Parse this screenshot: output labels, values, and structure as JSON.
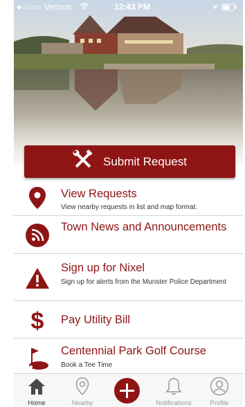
{
  "status_bar": {
    "carrier": "●○○○○ Verizon",
    "time": "12:43 PM"
  },
  "submit_button": {
    "label": "Submit Request"
  },
  "menu": [
    {
      "title": "View Requests",
      "subtitle": "View nearby requests in list and map format."
    },
    {
      "title": "Town News and Announcements",
      "subtitle": ""
    },
    {
      "title": "Sign up for Nixel",
      "subtitle": "Sign up for alerts from the Munster Police Department"
    },
    {
      "title": "Pay Utility Bill",
      "subtitle": ""
    },
    {
      "title": "Centennial Park Golf Course",
      "subtitle": "Book a Tee Time"
    }
  ],
  "tabs": [
    {
      "label": "Home",
      "icon": "home-icon"
    },
    {
      "label": "Nearby",
      "icon": "location-pin-icon"
    },
    {
      "label": "",
      "icon": "plus-icon"
    },
    {
      "label": "Notifications",
      "icon": "bell-icon"
    },
    {
      "label": "Profile",
      "icon": "person-icon"
    }
  ],
  "colors": {
    "brand": "#8f1515",
    "divider": "#d4d4d4"
  }
}
